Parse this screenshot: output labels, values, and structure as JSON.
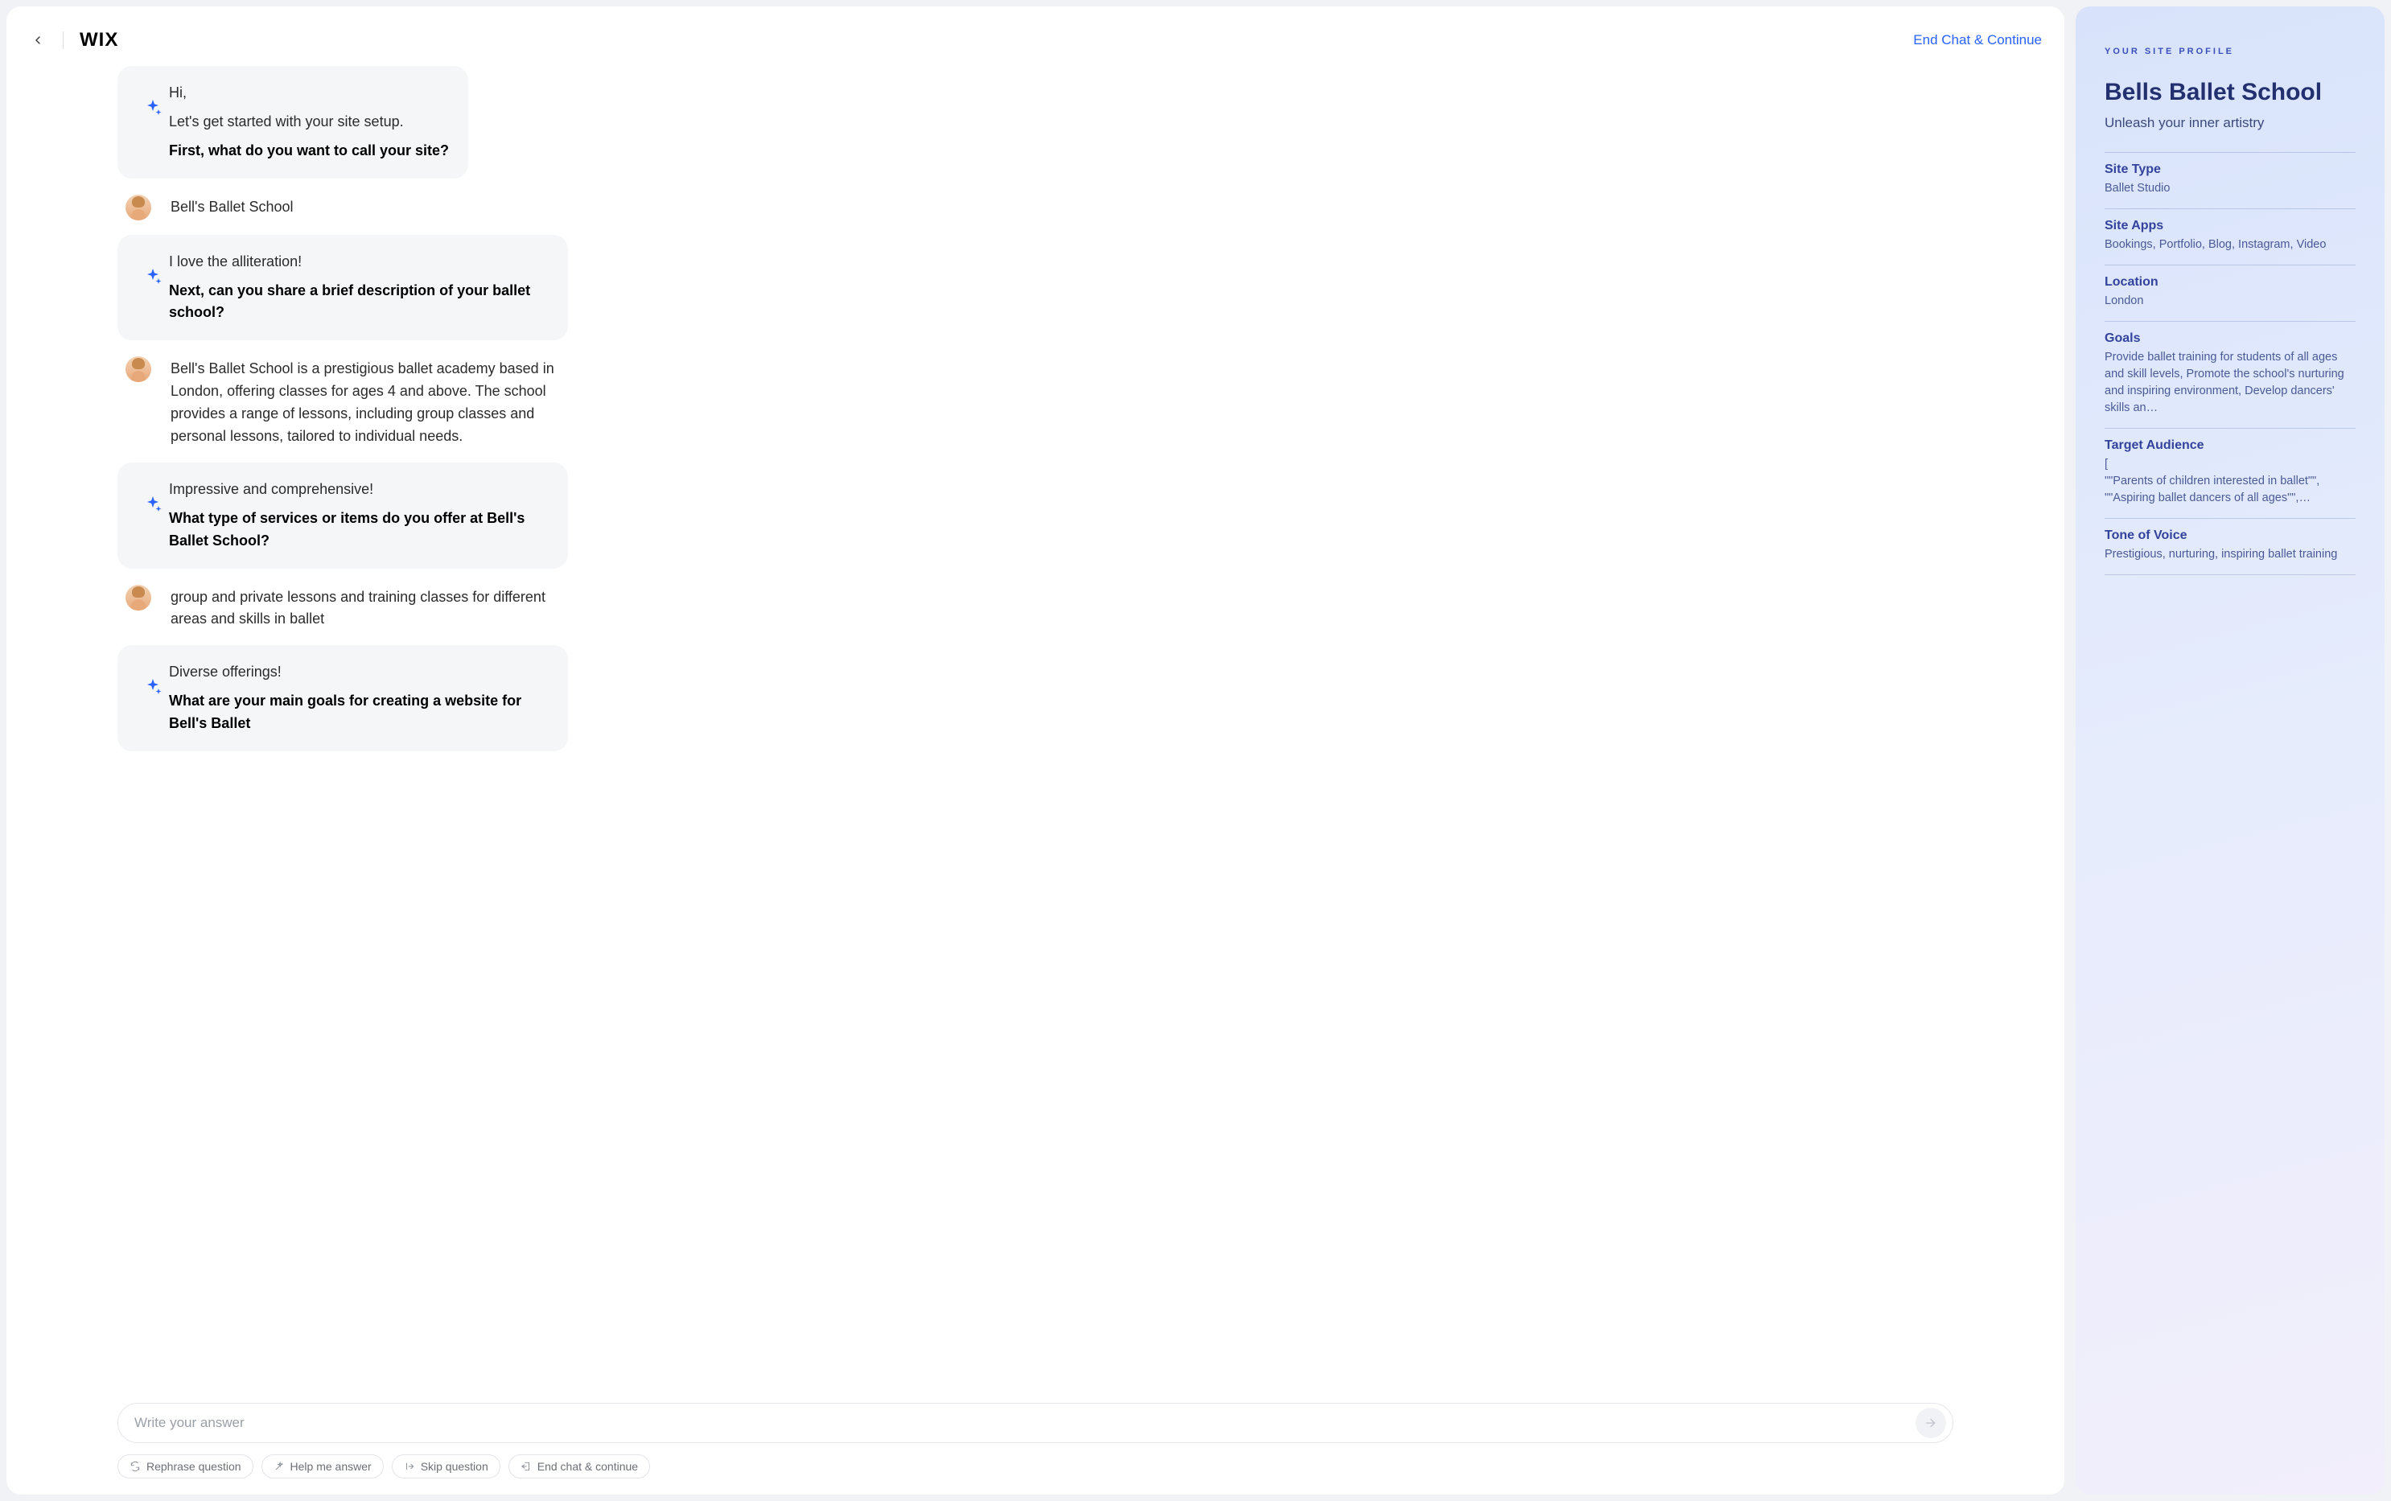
{
  "header": {
    "logo_text": "WIX",
    "end_chat_link": "End Chat & Continue"
  },
  "chat": {
    "messages": [
      {
        "role": "ai",
        "lines": [
          "Hi,",
          "Let's get started with your site setup."
        ],
        "bold": "First, what do you want to call your site?"
      },
      {
        "role": "user",
        "text": "Bell's Ballet School"
      },
      {
        "role": "ai",
        "lines": [
          "I love the alliteration!"
        ],
        "bold": "Next, can you share a brief description of your ballet school?"
      },
      {
        "role": "user",
        "text": "Bell's Ballet School is a prestigious ballet academy based in London, offering classes for ages 4 and above. The school provides a range of lessons, including group classes and personal lessons, tailored to individual needs."
      },
      {
        "role": "ai",
        "lines": [
          "Impressive and comprehensive!"
        ],
        "bold": "What type of services or items do you offer at Bell's Ballet School?"
      },
      {
        "role": "user",
        "text": "group and private lessons and training classes for different areas and skills in ballet"
      },
      {
        "role": "ai",
        "lines": [
          "Diverse offerings!"
        ],
        "bold": "What are your main goals for creating a website for Bell's Ballet"
      }
    ]
  },
  "input": {
    "placeholder": "Write your answer"
  },
  "quick_actions": {
    "rephrase": "Rephrase question",
    "help": "Help me answer",
    "skip": "Skip question",
    "end": "End chat & continue"
  },
  "side": {
    "eyebrow": "YOUR SITE PROFILE",
    "title": "Bells Ballet School",
    "tagline": "Unleash your inner artistry",
    "blocks": [
      {
        "label": "Site Type",
        "value": "Ballet Studio"
      },
      {
        "label": "Site Apps",
        "value": "Bookings, Portfolio, Blog, Instagram, Video"
      },
      {
        "label": "Location",
        "value": "London"
      },
      {
        "label": "Goals",
        "value": "Provide ballet training for students of all ages and skill levels, Promote the school's nurturing and inspiring environment, Develop dancers' skills an…"
      },
      {
        "label": "Target Audience",
        "value": "[\n\"\"Parents of children interested in ballet\"\",\n\"\"Aspiring ballet dancers of all ages\"\",…"
      },
      {
        "label": "Tone of Voice",
        "value": "Prestigious, nurturing, inspiring ballet training"
      }
    ]
  }
}
